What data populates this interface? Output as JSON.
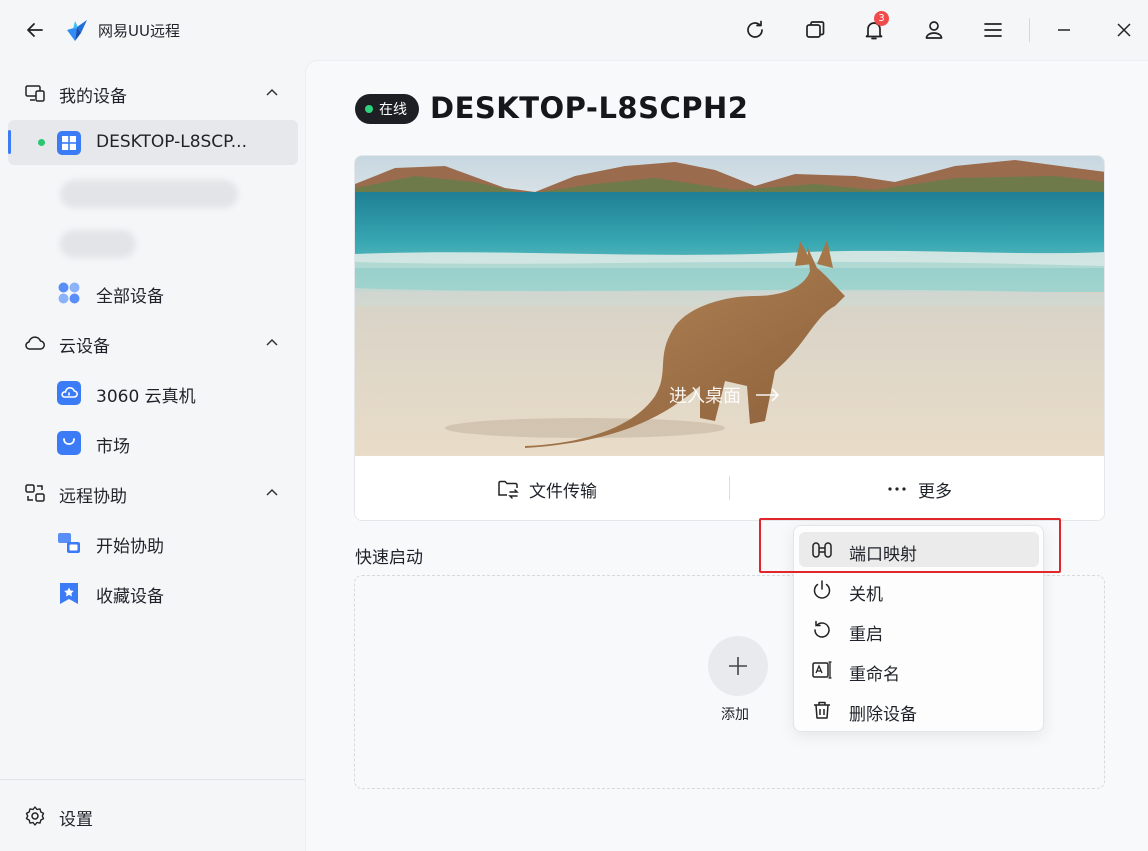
{
  "window": {
    "app_title": "网易UU远程",
    "notification_count": "3"
  },
  "sidebar": {
    "groups": [
      {
        "label": "我的设备"
      },
      {
        "label": "云设备"
      },
      {
        "label": "远程协助"
      }
    ],
    "my_devices": [
      {
        "label": "DESKTOP-L8SCP...",
        "status": "online"
      },
      {
        "label": "全部设备"
      }
    ],
    "cloud": [
      {
        "label": "3060 云真机"
      },
      {
        "label": "市场"
      }
    ],
    "assist": [
      {
        "label": "开始协助"
      },
      {
        "label": "收藏设备"
      }
    ],
    "settings_label": "设置"
  },
  "device": {
    "status_label": "在线",
    "name": "DESKTOP-L8SCPH2",
    "enter_desktop_label": "进入桌面",
    "file_transfer_label": "文件传输",
    "more_label": "更多"
  },
  "quick_launch": {
    "title": "快速启动",
    "add_label": "添加"
  },
  "more_menu": {
    "items": [
      {
        "label": "端口映射",
        "icon": "port-mapping-icon"
      },
      {
        "label": "关机",
        "icon": "power-icon"
      },
      {
        "label": "重启",
        "icon": "restart-icon"
      },
      {
        "label": "重命名",
        "icon": "rename-icon"
      },
      {
        "label": "删除设备",
        "icon": "trash-icon"
      }
    ]
  },
  "colors": {
    "accent": "#3b7cf6",
    "online": "#28c76f",
    "highlight_box": "#e0252b"
  }
}
